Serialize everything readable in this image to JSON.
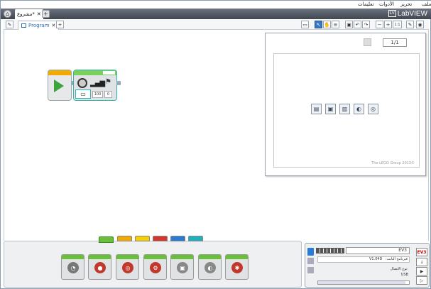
{
  "menu": {
    "file": "ملف",
    "edit": "تحرير",
    "tools": "الأدوات",
    "help": "تعليمات"
  },
  "brand": {
    "logo_text": "LabVIEW",
    "logo_mark": "LV"
  },
  "project_tab": {
    "label": "مشروع*",
    "close": "✕",
    "add": "+"
  },
  "program_tab": {
    "label": "Program",
    "close": "✕",
    "add": "+"
  },
  "toolbar": {
    "zoom_reset": "1:1"
  },
  "content_panel": {
    "page": "1/1",
    "copyright": "The LEGO Group 2013©"
  },
  "block": {
    "motor_value": "100",
    "sensor_value": "0"
  },
  "hardware": {
    "brick_name": "EV3",
    "firmware_label": "فيرنامج الثابت:",
    "firmware_value": "V1.04D",
    "connection_label": "نوع الاتصال:",
    "connection_value": "USB",
    "ev3_tab": "EV3"
  },
  "palette": {
    "tab_colors": [
      "#6abf3a",
      "#f2a900",
      "#f4d000",
      "#d9352b",
      "#2a7bd4",
      "#1fb0c0"
    ],
    "selected_tab": 0
  }
}
